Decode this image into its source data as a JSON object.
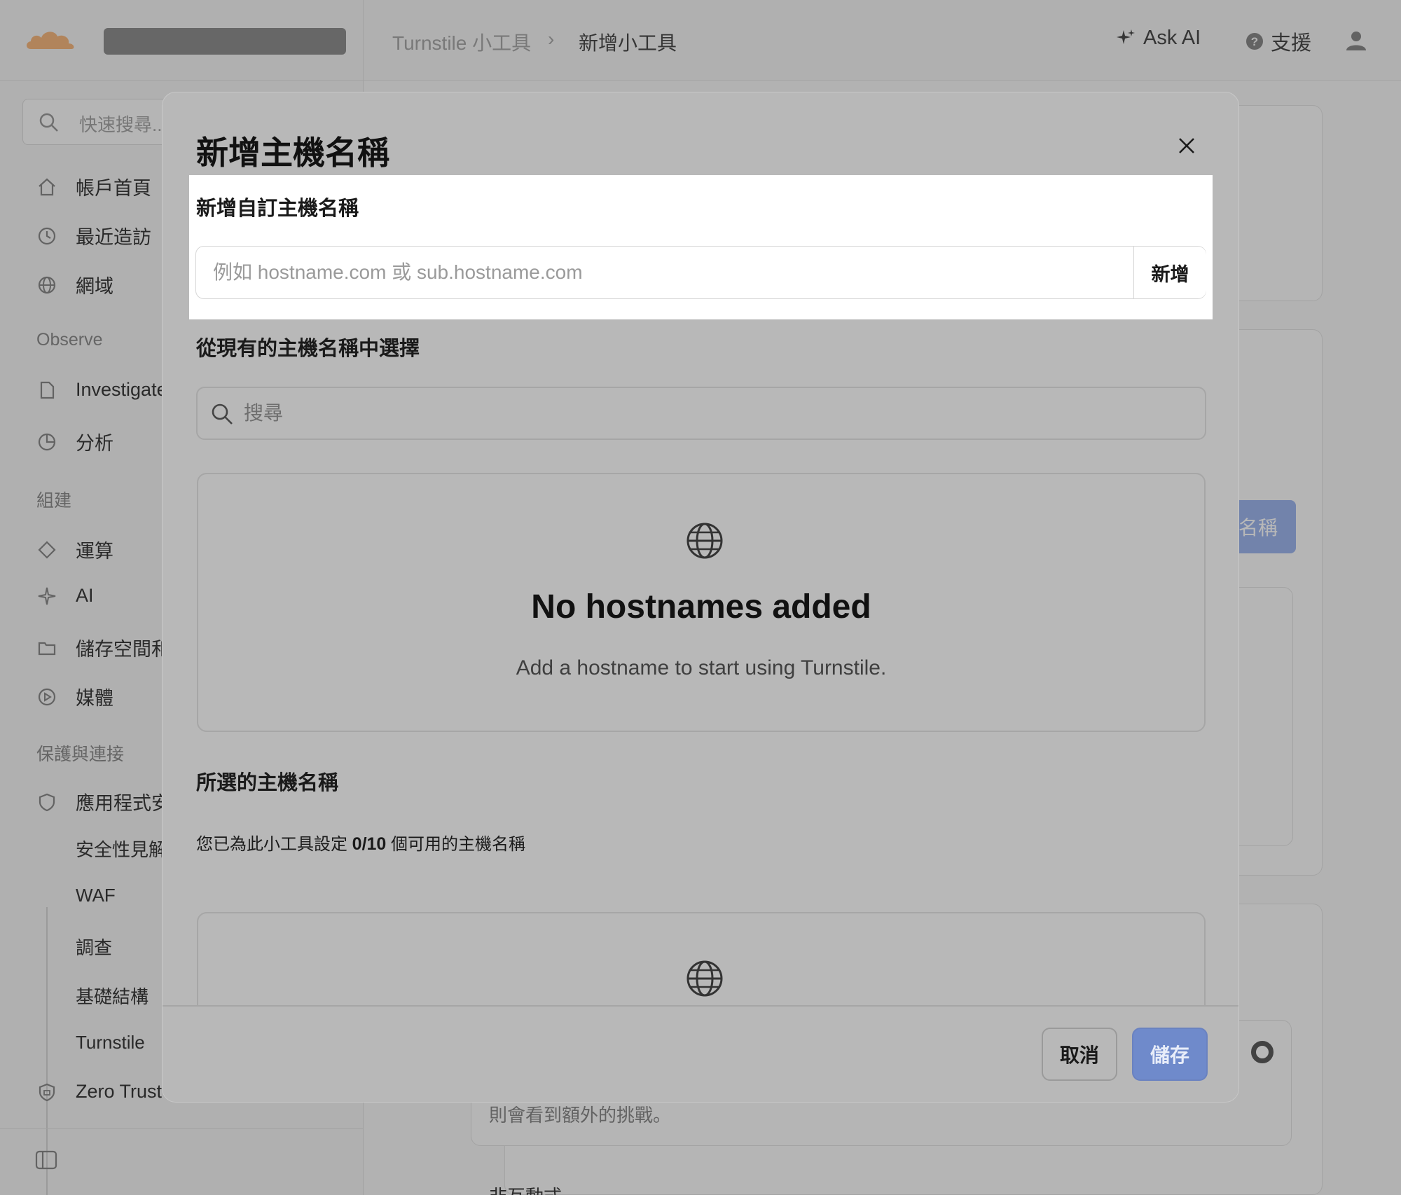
{
  "topbar": {
    "breadcrumb_parent": "Turnstile 小工具",
    "breadcrumb_separator": "›",
    "breadcrumb_current": "新增小工具",
    "ask_ai_label": "Ask AI",
    "support_label": "支援"
  },
  "sidebar": {
    "search_placeholder": "快速搜尋...",
    "items_top": [
      {
        "label": "帳戶首頁",
        "icon": "home-icon"
      },
      {
        "label": "最近造訪",
        "icon": "clock-icon"
      },
      {
        "label": "網域",
        "icon": "globe-icon"
      }
    ],
    "section_observe": "Observe",
    "items_observe": [
      {
        "label": "Investigate",
        "icon": "document-icon"
      },
      {
        "label": "分析",
        "icon": "pie-icon"
      }
    ],
    "section_build": "組建",
    "items_build": [
      {
        "label": "運算",
        "icon": "diamond-icon"
      },
      {
        "label": "AI",
        "icon": "sparkle-icon"
      },
      {
        "label": "儲存空間和",
        "icon": "folder-icon"
      },
      {
        "label": "媒體",
        "icon": "play-icon"
      }
    ],
    "section_protect": "保護與連接",
    "items_protect": [
      {
        "label": "應用程式安",
        "icon": "shield-icon"
      }
    ],
    "sub_items": [
      "安全性見解",
      "WAF",
      "調查",
      "基礎結構",
      "Turnstile"
    ],
    "item_zero_trust": {
      "label": "Zero Trust",
      "icon": "shield-lock-icon"
    }
  },
  "background": {
    "button_partial": "名稱",
    "text_challenge": "則會看到額外的挑戰。",
    "text_noninteractive": "非互動式"
  },
  "modal": {
    "title": "新增主機名稱",
    "custom_section_label": "新增自訂主機名稱",
    "custom_input_placeholder": "例如 hostname.com 或 sub.hostname.com",
    "custom_input_value": "",
    "add_button_label": "新增",
    "existing_section_label": "從現有的主機名稱中選擇",
    "search_placeholder": "搜尋",
    "search_value": "",
    "empty_title": "No hostnames added",
    "empty_subtitle": "Add a hostname to start using Turnstile.",
    "selected_section_label": "所選的主機名稱",
    "selected_count_prefix": "您已為此小工具設定",
    "selected_count_value": "0/10",
    "selected_count_suffix": "個可用的主機名稱",
    "cancel_label": "取消",
    "save_label": "儲存"
  },
  "colors": {
    "brand_orange": "#f38020",
    "primary_blue": "#6f8acb",
    "highlight_bg": "#ffffff"
  }
}
